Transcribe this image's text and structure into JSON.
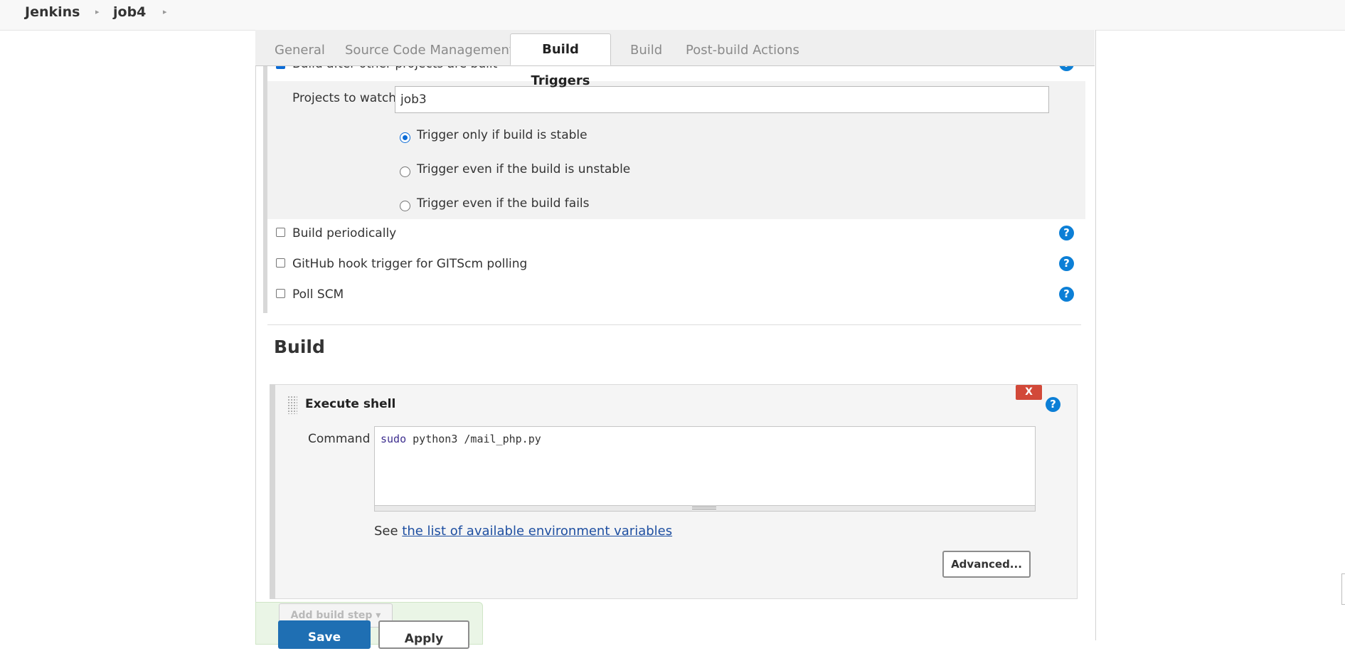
{
  "breadcrumb": {
    "root": "Jenkins",
    "job": "job4"
  },
  "tabs": {
    "general": "General",
    "scm": "Source Code Management",
    "triggers": "Build Triggers",
    "build": "Build",
    "post": "Post-build Actions"
  },
  "triggers": {
    "after_other": {
      "label": "Build after other projects are built",
      "checked": true
    },
    "projects_label": "Projects to watch",
    "projects_value": "job3",
    "radios": [
      {
        "label": "Trigger only if build is stable",
        "selected": true
      },
      {
        "label": "Trigger even if the build is unstable",
        "selected": false
      },
      {
        "label": "Trigger even if the build fails",
        "selected": false
      }
    ],
    "periodic": "Build periodically",
    "github_hook": "GitHub hook trigger for GITScm polling",
    "poll_scm": "Poll SCM"
  },
  "build": {
    "title": "Build",
    "step_title": "Execute shell",
    "delete_label": "X",
    "command_label": "Command",
    "command_kw": "sudo",
    "command_rest": " python3 /mail_php.py",
    "see_prefix": "See ",
    "env_link": "the list of available environment variables",
    "advanced": "Advanced...",
    "add_step": "Add build step"
  },
  "actions": {
    "save": "Save",
    "apply": "Apply"
  },
  "help_glyph": "?",
  "colors": {
    "accent": "#0b6bd6",
    "help": "#0c7fd6",
    "delete": "#d24939",
    "save": "#1f6fb3"
  }
}
